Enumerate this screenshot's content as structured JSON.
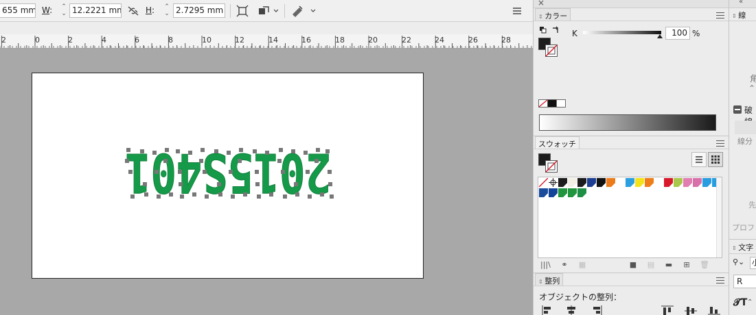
{
  "control_bar": {
    "x_value": "655 mm",
    "w_label": "W",
    "w_value": "12.2221 mm",
    "h_label": "H",
    "h_value": "2.7295 mm"
  },
  "ruler": {
    "ticks": [
      "2",
      "0",
      "2",
      "4",
      "6",
      "8",
      "10",
      "12",
      "14",
      "16",
      "18",
      "20",
      "22",
      "24",
      "26",
      "28"
    ]
  },
  "page_text": "2015S401",
  "color_panel": {
    "title": "カラー",
    "channel": "K",
    "k_value": "100",
    "percent": "%"
  },
  "swatches_panel": {
    "title": "スウォッチ",
    "colors": [
      "#1d1d1d",
      "#f2efe6",
      "#1c1c1c",
      "#1d3e93",
      "#121212",
      "#ec7c1b",
      "#ffffff",
      "#2c9fe1",
      "#f4e21b",
      "#ef7e1a",
      "#ffffff",
      "#d8192c",
      "#a9c84b",
      "#e27db1",
      "#d871a9",
      "#2a9ce0",
      "#299ce0",
      "#1b4b9b",
      "#14449a",
      "#22963f",
      "#22963e",
      "#1e9046"
    ]
  },
  "align_panel": {
    "title": "整列",
    "subtitle": "オブジェクトの整列："
  },
  "stroke_panel": {
    "title": "線",
    "corner_label": "角",
    "dash_label": "破線",
    "segment_label": "線分",
    "start_label": "先",
    "profile_label": "プロフ"
  },
  "character_panel": {
    "title": "文字",
    "search_value": "小",
    "style_value": "R"
  }
}
